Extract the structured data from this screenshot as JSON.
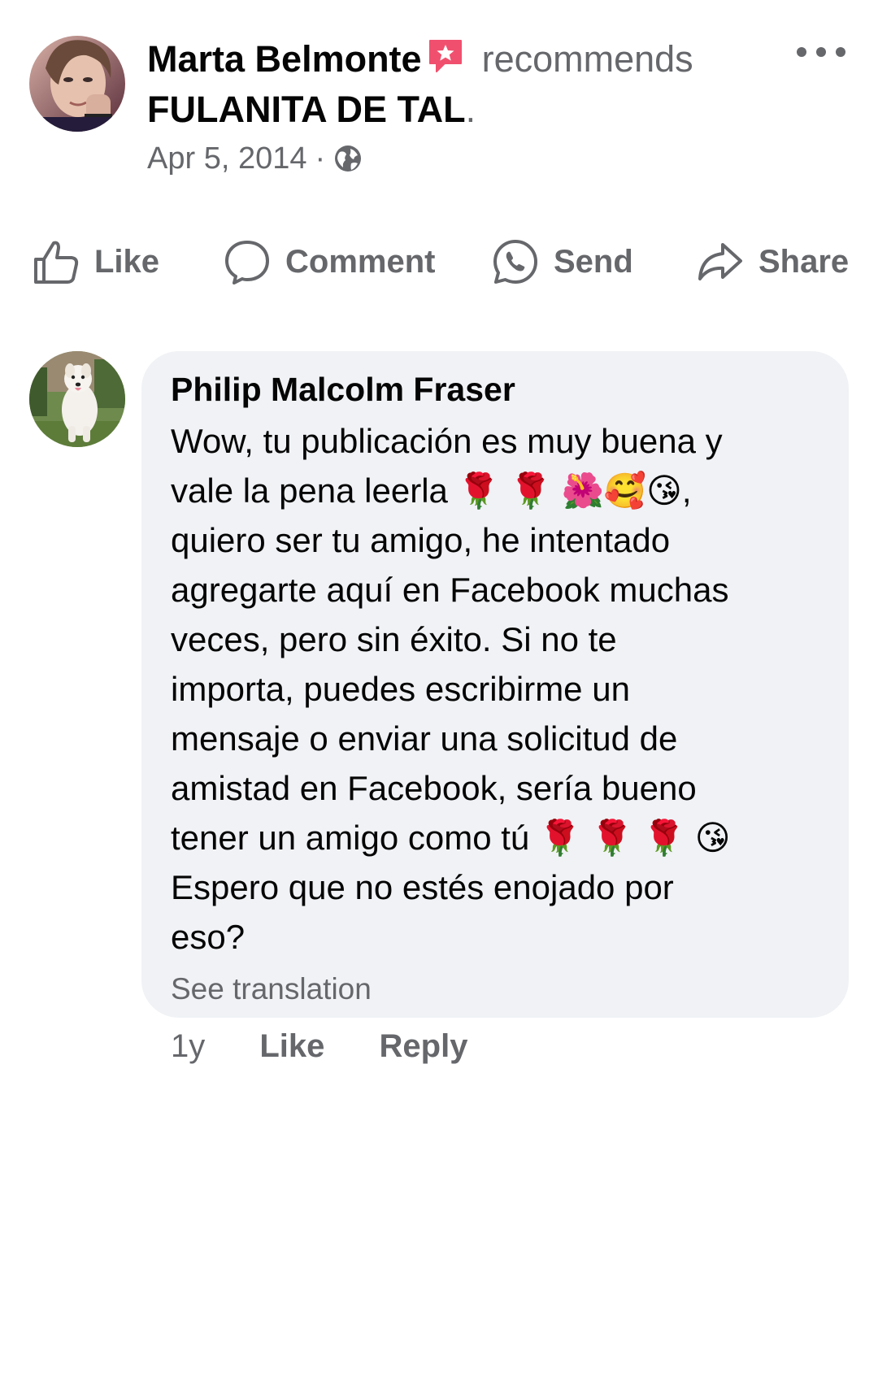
{
  "post": {
    "author": "Marta Belmonte",
    "action": "recommends",
    "page": "FULANITA DE TAL",
    "period": ".",
    "date": "Apr 5, 2014",
    "separator": "·",
    "privacy_icon": "globe-icon",
    "author_badge_icon": "star-recommend-icon",
    "more_icon": "more-dots-icon"
  },
  "actions": {
    "like": "Like",
    "comment": "Comment",
    "send": "Send",
    "share": "Share"
  },
  "comment": {
    "author": "Philip Malcolm Fraser",
    "lines": [
      "Wow, tu publicación es muy buena y",
      "vale la pena leerla 🌹 🌹 🌺🥰😘,",
      "quiero ser tu amigo, he intentado",
      "agregarte aquí en Facebook muchas",
      "veces, pero sin éxito. Si no te",
      "importa, puedes escribirme un",
      "mensaje o enviar una solicitud de",
      "amistad en Facebook, sería bueno",
      "tener un amigo como tú 🌹 🌹 🌹 😘",
      "Espero que no estés enojado por",
      "eso?"
    ],
    "see_translation": "See translation",
    "time": "1y",
    "like": "Like",
    "reply": "Reply"
  },
  "colors": {
    "primary_text": "#050505",
    "secondary_text": "#65676b",
    "bubble_bg": "#f0f2f5",
    "badge": "#f0506e"
  }
}
